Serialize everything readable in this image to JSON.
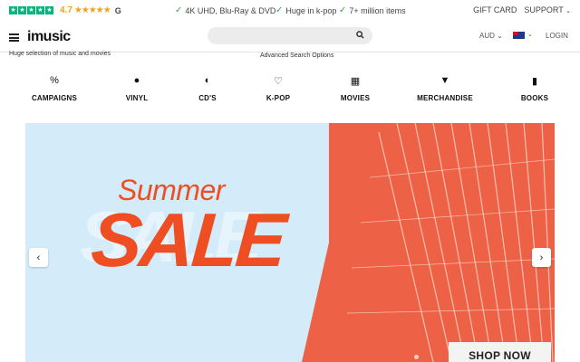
{
  "topbar": {
    "trustpilot_stars": 5,
    "rating": "4.7",
    "rating_stars": "★★★★★",
    "google_label": "G",
    "usps": [
      "4K UHD, Blu-Ray & DVD",
      "Huge in k-pop",
      "7+ million items"
    ],
    "gift_card": "GIFT CARD",
    "support": "SUPPORT",
    "caret": "⌄"
  },
  "header": {
    "logo": "imusic",
    "search_placeholder": "",
    "currency": "AUD ⌄",
    "flag_caret": "⌄",
    "login": "LOGIN",
    "subline": "Huge selection of music and movies",
    "advanced_search": "Advanced Search Options"
  },
  "categories": [
    {
      "label": "CAMPAIGNS",
      "icon": "percent-icon",
      "glyph": "%"
    },
    {
      "label": "VINYL",
      "icon": "vinyl-icon",
      "glyph": "●"
    },
    {
      "label": "CD'S",
      "icon": "cd-icon",
      "glyph": "◐"
    },
    {
      "label": "K-POP",
      "icon": "heart-hand-icon",
      "glyph": "♡"
    },
    {
      "label": "MOVIES",
      "icon": "film-icon",
      "glyph": "▦"
    },
    {
      "label": "MERCHANDISE",
      "icon": "tshirt-icon",
      "glyph": "▼"
    },
    {
      "label": "BOOKS",
      "icon": "book-icon",
      "glyph": "▮"
    }
  ],
  "hero": {
    "summer": "Summer",
    "sale": "SALE",
    "ghost": "SALE",
    "cta": "SHOP NOW",
    "prev": "‹",
    "next": "›"
  },
  "colors": {
    "accent_orange": "#ee4e22",
    "hero_bg": "#d4ebfa",
    "photo": "#ed6246",
    "trustpilot": "#00b67a",
    "star": "#f4a21a"
  }
}
